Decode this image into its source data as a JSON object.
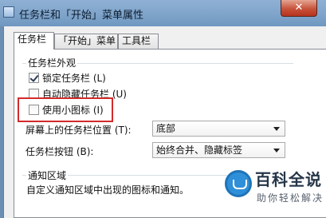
{
  "window": {
    "title": "任务栏和「开始」菜单属性",
    "close_glyph": "✕"
  },
  "tabs": [
    {
      "label": "任务栏",
      "active": true
    },
    {
      "label": "「开始」菜单",
      "active": false
    },
    {
      "label": "工具栏",
      "active": false
    }
  ],
  "appearance": {
    "group_label": "任务栏外观",
    "options": [
      {
        "label": "锁定任务栏 (L)",
        "checked": true
      },
      {
        "label": "自动隐藏任务栏 (U)",
        "checked": false
      },
      {
        "label": "使用小图标 (I)",
        "checked": false
      }
    ],
    "position_label": "屏幕上的任务栏位置 (T):",
    "position_value": "底部",
    "buttons_label": "任务栏按钮 (B):",
    "buttons_value": "始终合并、隐藏标签"
  },
  "notification": {
    "group_label": "通知区域",
    "description": "自定义通知区域中出现的图标和通知。"
  },
  "watermark": {
    "text": "百科全说",
    "subtext": "助你轻松解决"
  },
  "colors": {
    "highlight": "#d42a2a",
    "titlebar": "#7ea3c9",
    "close": "#c7523a"
  }
}
